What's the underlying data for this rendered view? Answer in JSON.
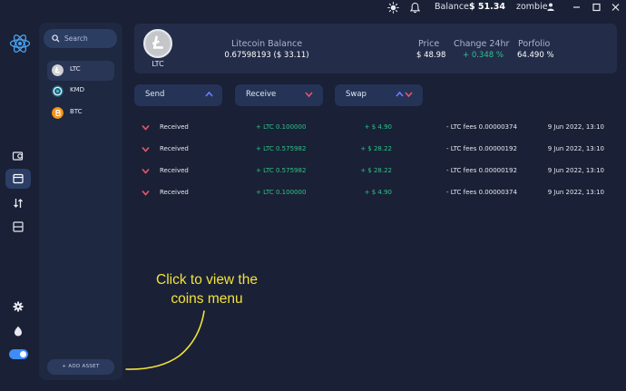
{
  "titlebar": {
    "icons": [
      "sun-icon",
      "bell-icon",
      "user-icon",
      "minimize-icon",
      "maximize-icon",
      "close-icon"
    ],
    "balance_label": "Balance",
    "balance_value": "$ 51.34",
    "username": "zombie"
  },
  "sidebar": {
    "logo": "atom-logo-icon",
    "nav_icons": [
      "wallet-icon",
      "portfolio-icon",
      "exchange-icon",
      "receive-icon",
      "settings-icon",
      "theme-icon"
    ],
    "toggle_on": true
  },
  "coins_panel": {
    "search_placeholder": "Search",
    "coins": [
      {
        "symbol": "LTC",
        "icon": "litecoin-icon",
        "color": "#d0d1d4",
        "selected": true
      },
      {
        "symbol": "KMD",
        "icon": "komodo-icon",
        "color": "#2a8fb0",
        "selected": false
      },
      {
        "symbol": "BTC",
        "icon": "bitcoin-icon",
        "color": "#f7931a",
        "selected": false
      }
    ],
    "add_asset_label": "+ ADD ASSET"
  },
  "header": {
    "coin_symbol": "LTC",
    "balance_label": "Litecoin Balance",
    "balance_value": "0.67598193 ($ 33.11)",
    "price_label": "Price",
    "price_value": "$ 48.98",
    "change_label": "Change 24hr",
    "change_value": "+ 0.348 %",
    "portfolio_label": "Porfolio",
    "portfolio_value": "64.490 %"
  },
  "actions": {
    "send": "Send",
    "receive": "Receive",
    "swap": "Swap"
  },
  "transactions": [
    {
      "type": "Received",
      "amount": "+ LTC 0.100000",
      "usd": "+ $ 4.90",
      "fee": "- LTC fees 0.00000374",
      "date": "9 Jun 2022, 13:10"
    },
    {
      "type": "Received",
      "amount": "+ LTC 0.575982",
      "usd": "+ $ 28.22",
      "fee": "- LTC fees 0.00000192",
      "date": "9 Jun 2022, 13:10"
    },
    {
      "type": "Received",
      "amount": "+ LTC 0.575982",
      "usd": "+ $ 28.22",
      "fee": "- LTC fees 0.00000192",
      "date": "9 Jun 2022, 13:10"
    },
    {
      "type": "Received",
      "amount": "+ LTC 0.100000",
      "usd": "+ $ 4.90",
      "fee": "- LTC fees 0.00000374",
      "date": "9 Jun 2022, 13:10"
    }
  ],
  "annotation": {
    "line1": "Click to view the",
    "line2": "coins menu"
  },
  "colors": {
    "background": "#1a2035",
    "panel": "#1e2840",
    "accent": "#3e8cf7",
    "positive": "#2dc48a",
    "negative": "#e5566a",
    "annotation": "#f2e23a"
  }
}
